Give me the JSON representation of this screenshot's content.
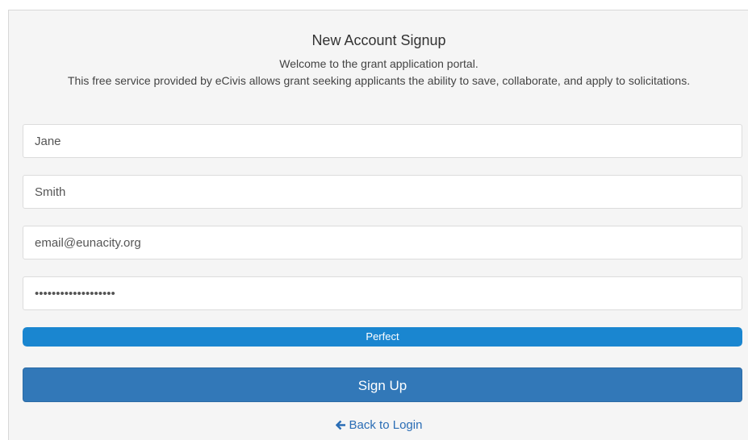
{
  "form": {
    "title": "New Account Signup",
    "intro_line1": "Welcome to the grant application portal.",
    "intro_line2": "This free service provided by eCivis allows grant seeking applicants the ability to save, collaborate, and apply to solicitations.",
    "first_name_value": "Jane",
    "last_name_value": "Smith",
    "email_value": "email@eunacity.org",
    "password_value": "•••••••••••••••••••",
    "strength_label": "Perfect",
    "strength_level": 1.0,
    "signup_label": "Sign Up",
    "back_label": "Back to Login",
    "back_icon": "arrow-left-icon"
  },
  "colors": {
    "primary": "#3278b8",
    "strength": "#1a86d0",
    "link": "#2a6db5",
    "panel_bg": "#f5f5f5"
  }
}
